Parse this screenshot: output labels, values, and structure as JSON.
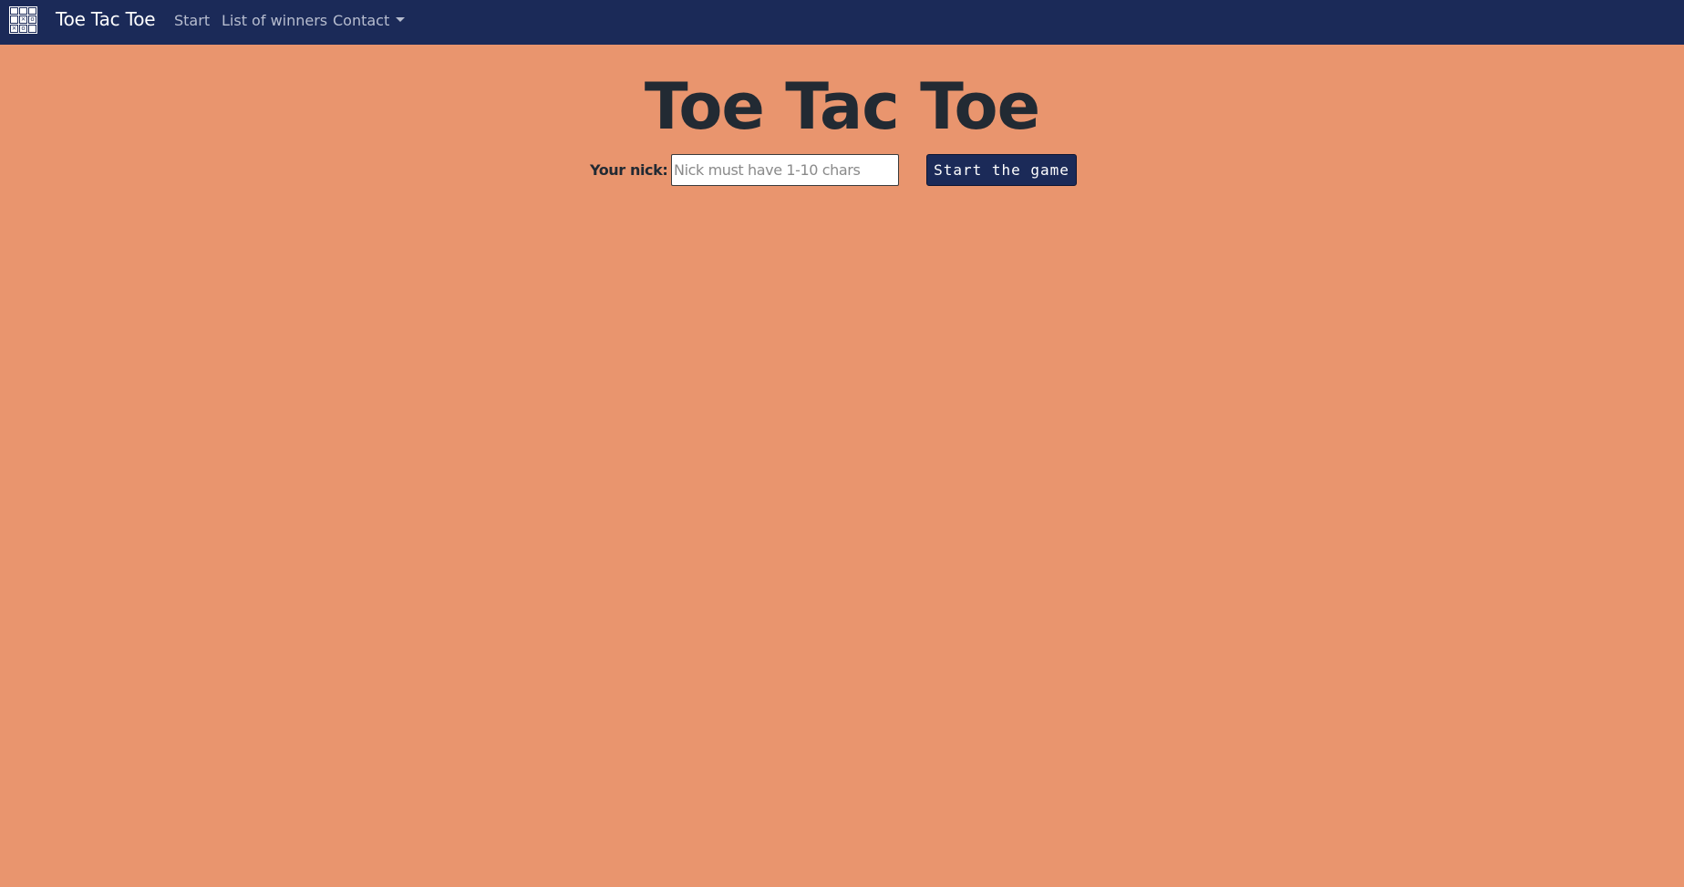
{
  "navbar": {
    "brand_title": "Toe Tac Toe",
    "logo_cells": [
      "",
      "",
      "",
      "",
      "×",
      "o",
      "×",
      "o",
      ""
    ],
    "links": {
      "start": "Start",
      "winners": "List of winners",
      "contact": "Contact"
    },
    "background_color": "#1b2a58"
  },
  "main": {
    "title": "Toe Tac Toe",
    "nick_label": "Your nick:",
    "nick_input": {
      "value": "",
      "placeholder": "Nick must have 1-10 chars"
    },
    "start_button": "Start the game",
    "background_color": "#e9956e"
  },
  "icons": {
    "logo": "tic-tac-toe-board-icon",
    "contact_dropdown": "caret-down-icon"
  }
}
